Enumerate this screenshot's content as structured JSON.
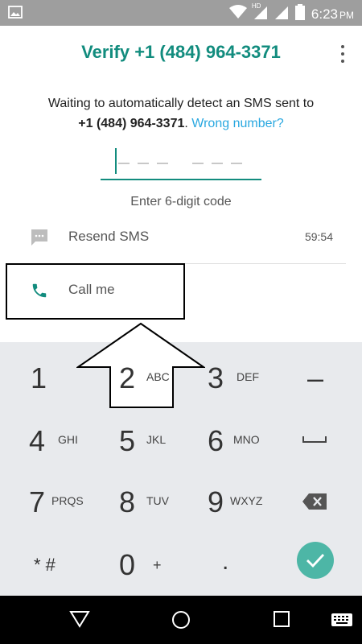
{
  "status_bar": {
    "time": "6:23",
    "ampm": "PM",
    "network_label": "HD"
  },
  "header": {
    "title": "Verify +1 (484) 964-3371"
  },
  "description": {
    "line1": "Waiting to automatically detect an SMS sent to",
    "number": "+1 (484) 964-3371",
    "period": ".",
    "wrong_number_link": "Wrong number?"
  },
  "code_input": {
    "hint": "Enter 6-digit code"
  },
  "options": {
    "resend": {
      "label": "Resend SMS",
      "timer": "59:54"
    },
    "call": {
      "label": "Call me"
    }
  },
  "keypad": {
    "keys": [
      {
        "digit": "1",
        "letters": ""
      },
      {
        "digit": "2",
        "letters": "ABC"
      },
      {
        "digit": "3",
        "letters": "DEF"
      },
      {
        "digit": "–",
        "letters": ""
      },
      {
        "digit": "4",
        "letters": "GHI"
      },
      {
        "digit": "5",
        "letters": "JKL"
      },
      {
        "digit": "6",
        "letters": "MNO"
      },
      {
        "digit": "7",
        "letters": "PRQS"
      },
      {
        "digit": "8",
        "letters": "TUV"
      },
      {
        "digit": "9",
        "letters": "WXYZ"
      },
      {
        "digit": "* #",
        "letters": ""
      },
      {
        "digit": "0",
        "letters": "+"
      },
      {
        "digit": ".",
        "letters": ""
      }
    ]
  },
  "colors": {
    "accent": "#128c7e",
    "link": "#2aa8e0",
    "confirm": "#4db6a6",
    "keypad_bg": "#e8eaed"
  },
  "icons": {
    "status": [
      "image-icon",
      "wifi-icon",
      "signal-icon",
      "battery-icon"
    ],
    "nav": [
      "back-icon",
      "home-icon",
      "recents-icon",
      "keyboard-icon"
    ]
  }
}
